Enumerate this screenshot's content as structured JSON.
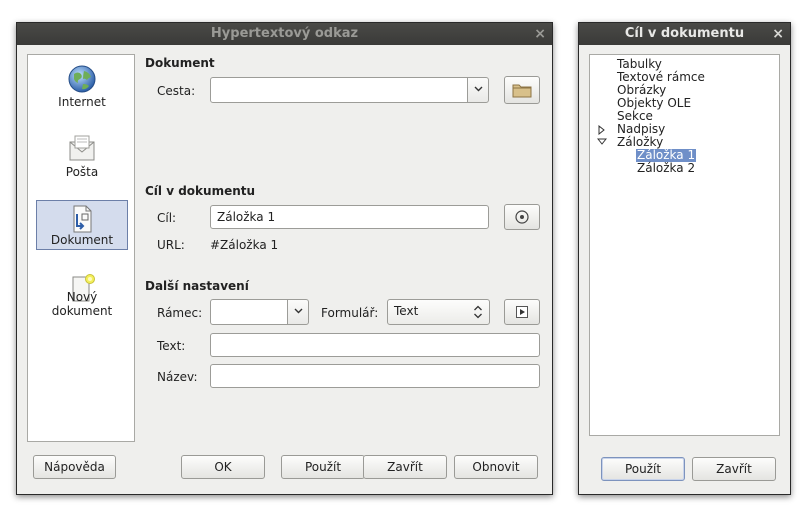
{
  "hyperlink_dialog": {
    "title": "Hypertextový odkaz",
    "close_glyph": "×",
    "sidebar": {
      "items": [
        {
          "label": "Internet",
          "icon": "globe-icon"
        },
        {
          "label": "Pošta",
          "icon": "mail-icon"
        },
        {
          "label": "Dokument",
          "icon": "document-target-icon",
          "selected": true
        },
        {
          "label": "Nový dokument",
          "icon": "new-document-icon"
        }
      ]
    },
    "document": {
      "heading": "Dokument",
      "path_label": "Cesta:",
      "path_value": ""
    },
    "target": {
      "heading": "Cíl v dokumentu",
      "target_label": "Cíl:",
      "target_value": "Záložka 1",
      "url_label": "URL:",
      "url_value": "#Záložka 1"
    },
    "further": {
      "heading": "Další nastavení",
      "frame_label": "Rámec:",
      "frame_value": "",
      "form_label": "Formulář:",
      "form_value": "Text",
      "text_label": "Text:",
      "text_value": "",
      "name_label": "Název:",
      "name_value": ""
    },
    "buttons": {
      "help": "Nápověda",
      "ok": "OK",
      "apply": "Použít",
      "close": "Zavřít",
      "reset": "Obnovit"
    }
  },
  "target_dialog": {
    "title": "Cíl v dokumentu",
    "close_glyph": "×",
    "tree": [
      {
        "label": "Tabulky"
      },
      {
        "label": "Textové rámce"
      },
      {
        "label": "Obrázky"
      },
      {
        "label": "Objekty OLE"
      },
      {
        "label": "Sekce"
      },
      {
        "label": "Nadpisy"
      },
      {
        "label": "Záložky"
      },
      {
        "label": "Záložka 1"
      },
      {
        "label": "Záložka 2"
      }
    ],
    "buttons": {
      "apply": "Použít",
      "close": "Zavřít"
    }
  }
}
